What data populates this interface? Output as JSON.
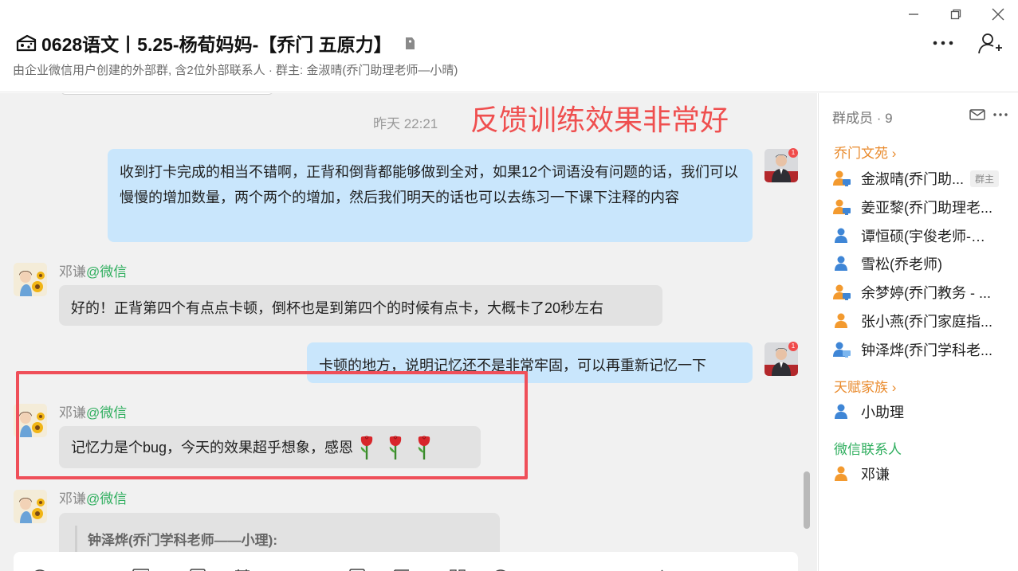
{
  "header": {
    "title": "0628语文丨5.25-杨荀妈妈-【乔门 五原力】",
    "subtitle": "由企业微信用户创建的外部群, 含2位外部联系人 · 群主: 金淑晴(乔门助理老师—小晴)"
  },
  "chat": {
    "timestamp": "昨天 22:21",
    "annotation": "反馈训练效果非常好",
    "messages": [
      {
        "text": "收到打卡完成的相当不错啊，正背和倒背都能够做到全对，如果12个词语没有问题的话，我们可以慢慢的增加数量，两个两个的增加，然后我们明天的话也可以去练习一下课下注释的内容",
        "badge": "1"
      },
      {
        "sender": "邓谦",
        "source": "@微信",
        "text": "好的！正背第四个有点点卡顿，倒杯也是到第四个的时候有点卡，大概卡了20秒左右"
      },
      {
        "text": "卡顿的地方，说明记忆还不是非常牢固，可以再重新记忆一下",
        "badge": "1"
      },
      {
        "sender": "邓谦",
        "source": "@微信",
        "text": "记忆力是个bug，今天的效果超乎想象，感恩"
      },
      {
        "sender": "邓谦",
        "source": "@微信",
        "quote": "钟泽烨(乔门学科老师——小理):"
      }
    ]
  },
  "sidebar": {
    "title": "群成员 · 9",
    "sections": [
      {
        "label": "乔门文苑 ›",
        "color": "orange"
      },
      {
        "label": "天赋家族 ›",
        "color": "orange"
      },
      {
        "label": "微信联系人",
        "color": "green"
      }
    ],
    "members": [
      {
        "name": "金淑晴(乔门助...",
        "role": "群主",
        "icon": "orange-screen"
      },
      {
        "name": "姜亚黎(乔门助理老...",
        "icon": "orange-screen"
      },
      {
        "name": "谭恒硕(宇俊老师-乔...",
        "icon": "blue"
      },
      {
        "name": "雪松(乔老师)",
        "icon": "blue"
      },
      {
        "name": "余梦婷(乔门教务 - ...",
        "icon": "orange-screen"
      },
      {
        "name": "张小燕(乔门家庭指...",
        "icon": "orange"
      },
      {
        "name": "钟泽烨(乔门学科老...",
        "icon": "blue-screen"
      },
      {
        "name": "小助理",
        "icon": "blue"
      },
      {
        "name": "邓谦",
        "icon": "orange"
      }
    ]
  },
  "colors": {
    "accent_red": "#ef4f4f",
    "wechat_green": "#2fae5e",
    "section_orange": "#e98a2c",
    "bubble_me": "#c9e6fc",
    "bubble_other": "#e2e2e2"
  }
}
